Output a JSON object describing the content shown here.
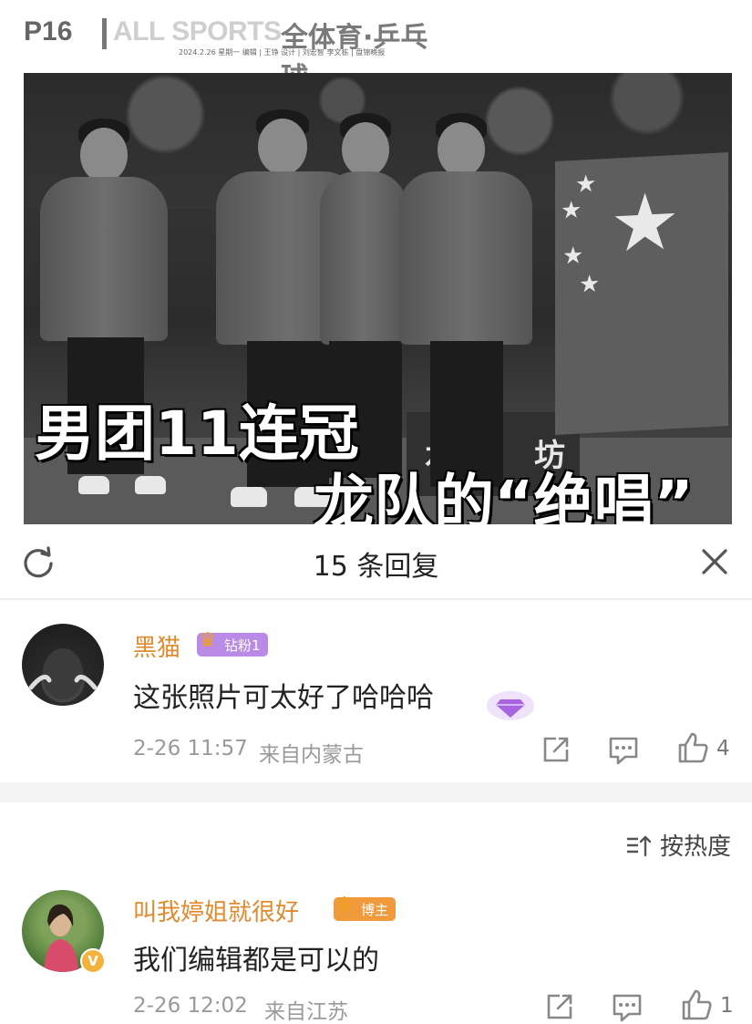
{
  "newspaper": {
    "page_number": "P16",
    "section": "ALL SPORTS",
    "topic": "全体育·乒乓球",
    "meta": "2024.2.26   星期一   编辑 | 王铮   设计 | 刘宏智   李文栋 | 盘锦晚报"
  },
  "photo": {
    "banner_left": "水",
    "banner_right": "坊",
    "headline_line1": "男团11连冠",
    "headline_line2": "龙队的“绝唱”"
  },
  "replies": {
    "title": "15 条回复"
  },
  "comments": [
    {
      "username": "黑猫",
      "badge": "钻粉1",
      "badge_color": "#b98be6",
      "text": "这张照片可太好了哈哈哈",
      "time": "2-26 11:57",
      "location": "来自内蒙古",
      "likes": "4"
    },
    {
      "username": "叫我婷姐就很好",
      "badge": "博主",
      "badge_color": "#f09a3c",
      "text": "我们编辑都是可以的",
      "time": "2-26 12:02",
      "location": "来自江苏",
      "likes": "1"
    }
  ],
  "sort": {
    "label": "按热度"
  },
  "colors": {
    "username": "#e08a2e",
    "meta_text": "#9a9a9a"
  }
}
